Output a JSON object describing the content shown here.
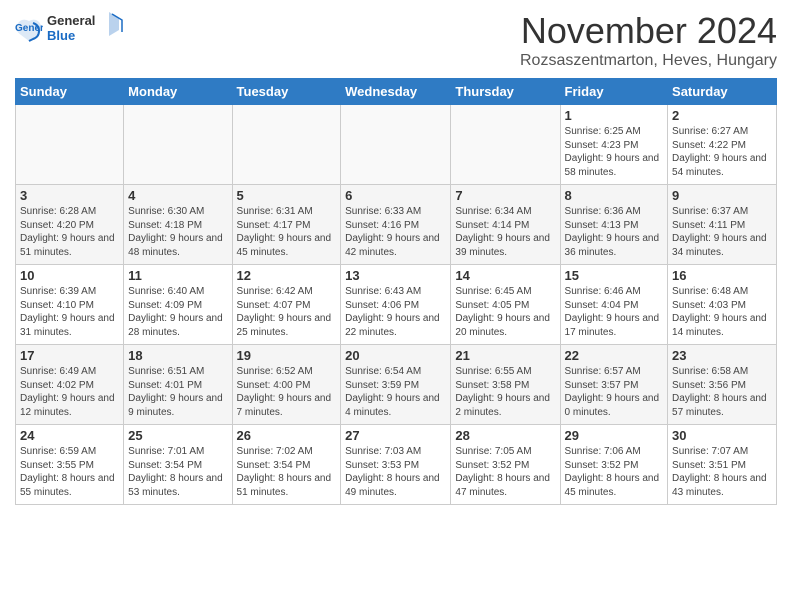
{
  "logo": {
    "general": "General",
    "blue": "Blue"
  },
  "title": "November 2024",
  "subtitle": "Rozsaszentmarton, Heves, Hungary",
  "days_of_week": [
    "Sunday",
    "Monday",
    "Tuesday",
    "Wednesday",
    "Thursday",
    "Friday",
    "Saturday"
  ],
  "weeks": [
    [
      {
        "num": "",
        "info": ""
      },
      {
        "num": "",
        "info": ""
      },
      {
        "num": "",
        "info": ""
      },
      {
        "num": "",
        "info": ""
      },
      {
        "num": "",
        "info": ""
      },
      {
        "num": "1",
        "info": "Sunrise: 6:25 AM\nSunset: 4:23 PM\nDaylight: 9 hours and 58 minutes."
      },
      {
        "num": "2",
        "info": "Sunrise: 6:27 AM\nSunset: 4:22 PM\nDaylight: 9 hours and 54 minutes."
      }
    ],
    [
      {
        "num": "3",
        "info": "Sunrise: 6:28 AM\nSunset: 4:20 PM\nDaylight: 9 hours and 51 minutes."
      },
      {
        "num": "4",
        "info": "Sunrise: 6:30 AM\nSunset: 4:18 PM\nDaylight: 9 hours and 48 minutes."
      },
      {
        "num": "5",
        "info": "Sunrise: 6:31 AM\nSunset: 4:17 PM\nDaylight: 9 hours and 45 minutes."
      },
      {
        "num": "6",
        "info": "Sunrise: 6:33 AM\nSunset: 4:16 PM\nDaylight: 9 hours and 42 minutes."
      },
      {
        "num": "7",
        "info": "Sunrise: 6:34 AM\nSunset: 4:14 PM\nDaylight: 9 hours and 39 minutes."
      },
      {
        "num": "8",
        "info": "Sunrise: 6:36 AM\nSunset: 4:13 PM\nDaylight: 9 hours and 36 minutes."
      },
      {
        "num": "9",
        "info": "Sunrise: 6:37 AM\nSunset: 4:11 PM\nDaylight: 9 hours and 34 minutes."
      }
    ],
    [
      {
        "num": "10",
        "info": "Sunrise: 6:39 AM\nSunset: 4:10 PM\nDaylight: 9 hours and 31 minutes."
      },
      {
        "num": "11",
        "info": "Sunrise: 6:40 AM\nSunset: 4:09 PM\nDaylight: 9 hours and 28 minutes."
      },
      {
        "num": "12",
        "info": "Sunrise: 6:42 AM\nSunset: 4:07 PM\nDaylight: 9 hours and 25 minutes."
      },
      {
        "num": "13",
        "info": "Sunrise: 6:43 AM\nSunset: 4:06 PM\nDaylight: 9 hours and 22 minutes."
      },
      {
        "num": "14",
        "info": "Sunrise: 6:45 AM\nSunset: 4:05 PM\nDaylight: 9 hours and 20 minutes."
      },
      {
        "num": "15",
        "info": "Sunrise: 6:46 AM\nSunset: 4:04 PM\nDaylight: 9 hours and 17 minutes."
      },
      {
        "num": "16",
        "info": "Sunrise: 6:48 AM\nSunset: 4:03 PM\nDaylight: 9 hours and 14 minutes."
      }
    ],
    [
      {
        "num": "17",
        "info": "Sunrise: 6:49 AM\nSunset: 4:02 PM\nDaylight: 9 hours and 12 minutes."
      },
      {
        "num": "18",
        "info": "Sunrise: 6:51 AM\nSunset: 4:01 PM\nDaylight: 9 hours and 9 minutes."
      },
      {
        "num": "19",
        "info": "Sunrise: 6:52 AM\nSunset: 4:00 PM\nDaylight: 9 hours and 7 minutes."
      },
      {
        "num": "20",
        "info": "Sunrise: 6:54 AM\nSunset: 3:59 PM\nDaylight: 9 hours and 4 minutes."
      },
      {
        "num": "21",
        "info": "Sunrise: 6:55 AM\nSunset: 3:58 PM\nDaylight: 9 hours and 2 minutes."
      },
      {
        "num": "22",
        "info": "Sunrise: 6:57 AM\nSunset: 3:57 PM\nDaylight: 9 hours and 0 minutes."
      },
      {
        "num": "23",
        "info": "Sunrise: 6:58 AM\nSunset: 3:56 PM\nDaylight: 8 hours and 57 minutes."
      }
    ],
    [
      {
        "num": "24",
        "info": "Sunrise: 6:59 AM\nSunset: 3:55 PM\nDaylight: 8 hours and 55 minutes."
      },
      {
        "num": "25",
        "info": "Sunrise: 7:01 AM\nSunset: 3:54 PM\nDaylight: 8 hours and 53 minutes."
      },
      {
        "num": "26",
        "info": "Sunrise: 7:02 AM\nSunset: 3:54 PM\nDaylight: 8 hours and 51 minutes."
      },
      {
        "num": "27",
        "info": "Sunrise: 7:03 AM\nSunset: 3:53 PM\nDaylight: 8 hours and 49 minutes."
      },
      {
        "num": "28",
        "info": "Sunrise: 7:05 AM\nSunset: 3:52 PM\nDaylight: 8 hours and 47 minutes."
      },
      {
        "num": "29",
        "info": "Sunrise: 7:06 AM\nSunset: 3:52 PM\nDaylight: 8 hours and 45 minutes."
      },
      {
        "num": "30",
        "info": "Sunrise: 7:07 AM\nSunset: 3:51 PM\nDaylight: 8 hours and 43 minutes."
      }
    ]
  ]
}
